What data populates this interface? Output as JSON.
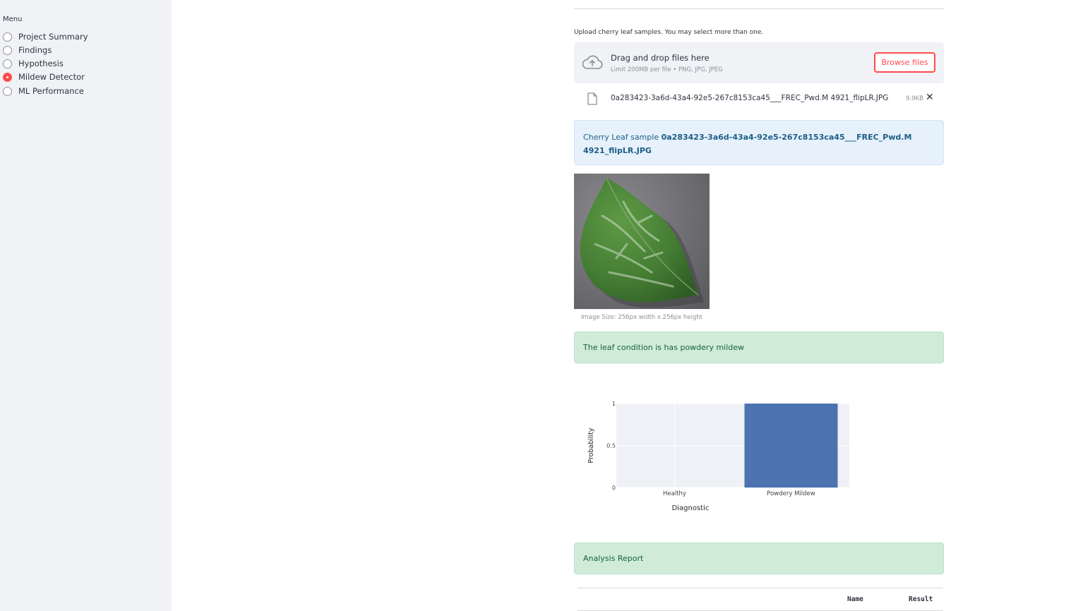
{
  "sidebar": {
    "menu_title": "Menu",
    "items": [
      {
        "label": "Project Summary",
        "selected": false
      },
      {
        "label": "Findings",
        "selected": false
      },
      {
        "label": "Hypothesis",
        "selected": false
      },
      {
        "label": "Mildew Detector",
        "selected": true
      },
      {
        "label": "ML Performance",
        "selected": false
      }
    ]
  },
  "uploader": {
    "label": "Upload cherry leaf samples. You may select more than one.",
    "drop_title": "Drag and drop files here",
    "drop_subtitle": "Limit 200MB per file • PNG, JPG, JPEG",
    "browse_label": "Browse files",
    "file": {
      "name": "0a283423-3a6d-43a4-92e5-267c8153ca45___FREC_Pwd.M 4921_flipLR.JPG",
      "size": "9.9KB",
      "remove_symbol": "✕"
    }
  },
  "info": {
    "prefix": "Cherry Leaf sample ",
    "filename": "0a283423-3a6d-43a4-92e5-267c8153ca45___FREC_Pwd.M 4921_flipLR.JPG"
  },
  "image": {
    "caption": "Image Size: 256px width x 256px height"
  },
  "result": {
    "message": "The leaf condition is has powdery mildew"
  },
  "chart_data": {
    "type": "bar",
    "categories": [
      "Healthy",
      "Powdery Mildew"
    ],
    "values": [
      0,
      1
    ],
    "xlabel": "Diagnostic",
    "ylabel": "Probability",
    "ylim": [
      0,
      1
    ],
    "yticks": [
      "0",
      "0.5",
      "1"
    ],
    "bar_color": "#4c72b0",
    "plot_bg": "#eff1f6"
  },
  "report": {
    "title": "Analysis Report",
    "columns": [
      "Name",
      "Result"
    ]
  },
  "colors": {
    "accent": "#ff4b4b",
    "sidebar_bg": "#f0f2f6",
    "info_bg": "#e6f1fb",
    "success_bg": "#d0ecd9"
  }
}
